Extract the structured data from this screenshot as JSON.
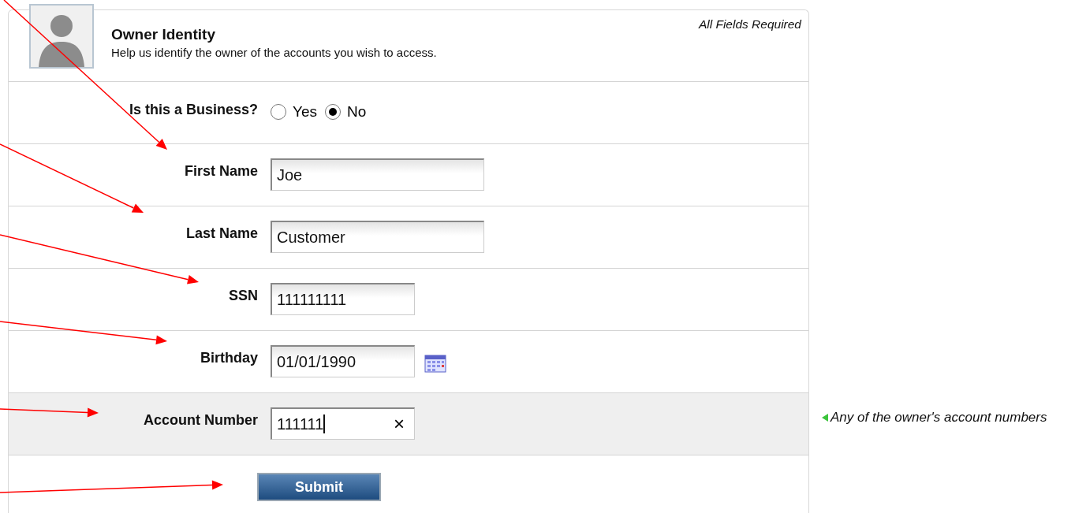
{
  "header": {
    "title": "Owner Identity",
    "subtitle": "Help us identify the owner of the accounts you wish to access.",
    "note": "All Fields Required"
  },
  "business": {
    "label": "Is this a Business?",
    "options": [
      {
        "label": "Yes",
        "selected": false
      },
      {
        "label": "No",
        "selected": true
      }
    ]
  },
  "fields": [
    {
      "label": "First Name",
      "value": "Joe",
      "kind": "text",
      "wide": true,
      "focused": false
    },
    {
      "label": "Last Name",
      "value": "Customer",
      "kind": "text",
      "wide": true,
      "focused": false
    },
    {
      "label": "SSN",
      "value": "111111111",
      "kind": "text",
      "wide": false,
      "focused": false
    },
    {
      "label": "Birthday",
      "value": "01/01/1990",
      "kind": "date",
      "wide": false,
      "focused": false
    },
    {
      "label": "Account Number",
      "value": "111111",
      "kind": "clearable",
      "wide": false,
      "focused": true,
      "clear": "×",
      "hint": "Any of the owner's account numbers"
    }
  ],
  "submit": {
    "label": "Submit"
  }
}
